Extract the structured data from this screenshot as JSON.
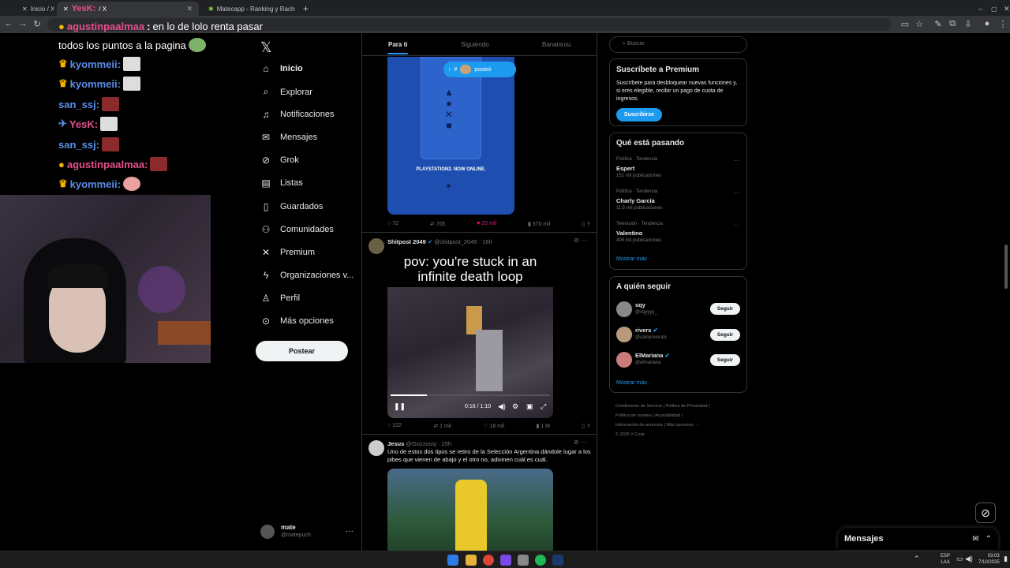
{
  "tabs": [
    {
      "label": "Inicio / X",
      "active": false
    },
    {
      "label": "YesK: ",
      "active": true,
      "suffix": "/ X"
    },
    {
      "label": "Matecapp - Ranking y Racha d",
      "active": false
    }
  ],
  "chat": [
    {
      "user": "agustinpaalmaa",
      "msg": "en lo de lolo renta pasar",
      "color": "#e4508c"
    },
    {
      "user": "",
      "msg": "todos los puntos a la pagina",
      "color": "#fff"
    },
    {
      "user": "kyommeii:",
      "msg": "",
      "color": "#5b8de8"
    },
    {
      "user": "kyommeii:",
      "msg": "",
      "color": "#5b8de8"
    },
    {
      "user": "san_ssj:",
      "msg": "",
      "color": "#5b8de8"
    },
    {
      "user": "YesK:",
      "msg": "",
      "color": "#e4508c"
    },
    {
      "user": "san_ssj:",
      "msg": "",
      "color": "#5b8de8"
    },
    {
      "user": "agustinpaalmaa:",
      "msg": "",
      "color": "#e4508c"
    },
    {
      "user": "kyommeii:",
      "msg": "",
      "color": "#5b8de8"
    }
  ],
  "nav": [
    {
      "label": "Inicio",
      "icon": "home-icon",
      "glyph": "⌂"
    },
    {
      "label": "Explorar",
      "icon": "search-icon",
      "glyph": "⌕"
    },
    {
      "label": "Notificaciones",
      "icon": "bell-icon",
      "glyph": "♫"
    },
    {
      "label": "Mensajes",
      "icon": "mail-icon",
      "glyph": "✉"
    },
    {
      "label": "Grok",
      "icon": "grok-icon",
      "glyph": "⊘"
    },
    {
      "label": "Listas",
      "icon": "list-icon",
      "glyph": "▤"
    },
    {
      "label": "Guardados",
      "icon": "bookmark-icon",
      "glyph": "▯"
    },
    {
      "label": "Comunidades",
      "icon": "communities-icon",
      "glyph": "⚇"
    },
    {
      "label": "Premium",
      "icon": "x-logo-icon",
      "glyph": "✕"
    },
    {
      "label": "Organizaciones v...",
      "icon": "lightning-icon",
      "glyph": "ϟ"
    },
    {
      "label": "Perfil",
      "icon": "person-icon",
      "glyph": "♙"
    },
    {
      "label": "Más opciones",
      "icon": "more-icon",
      "glyph": "⊙"
    }
  ],
  "post_button": "Postear",
  "account": {
    "name": "mate",
    "handle": "@matepuch"
  },
  "feed_tabs": [
    "Para ti",
    "Siguiendo",
    "Bananirou"
  ],
  "posted_pill": "posteó",
  "post1": {
    "poster_text": "PLAYSTATION2. NOW ONLINE.",
    "replies": "72",
    "reposts": "705",
    "likes": "20 mil",
    "views": "570 mil"
  },
  "post2": {
    "name": "Shitpost 2049",
    "handle": "@shitpost_2049 · 16h",
    "caption": "pov: you're stuck in an infinite death loop",
    "time": "0:16 / 1:10",
    "replies": "122",
    "reposts": "1 mil",
    "likes": "18 mil",
    "views": "1 M"
  },
  "post3": {
    "name": "Jesus",
    "handle": "@Gozzossj · 15h",
    "text": "Uno de estos dos tipos se retiro de la Selección Argentina dándole lugar a los pibes que vienen de abajo y el otro no, adivinen cuál es cuál."
  },
  "search_placeholder": "Buscar",
  "premium": {
    "title": "Suscríbete a Premium",
    "body": "Suscríbete para desbloquear nuevas funciones y, si eres elegible, recibir un pago de cuota de ingresos.",
    "button": "Suscribirse"
  },
  "trends": {
    "title": "Qué está pasando",
    "items": [
      {
        "cat": "Política · Tendencia",
        "name": "Espert",
        "count": "151 mil publicaciones"
      },
      {
        "cat": "Política · Tendencia",
        "name": "Charly García",
        "count": "11,5 mil publicaciones"
      },
      {
        "cat": "Televisión · Tendencia",
        "name": "Valentino",
        "count": "406 mil publicaciones"
      }
    ],
    "more": "Mostrar más"
  },
  "follow": {
    "title": "A quién seguir",
    "items": [
      {
        "name": "sqy",
        "handle": "@sqyyyy_"
      },
      {
        "name": "rivers",
        "handle": "@samyriveratv"
      },
      {
        "name": "ElMariana",
        "handle": "@elmariana"
      }
    ],
    "button": "Seguir",
    "more": "Mostrar más"
  },
  "footer": [
    "Condiciones de Servicio",
    "Política de Privacidad",
    "Política de cookies",
    "Accesibilidad",
    "Información de anuncios",
    "Más opciones ···",
    "© 2025 X Corp."
  ],
  "messages_dock": "Mensajes",
  "tray": {
    "lang": "ESP",
    "layout": "LAA",
    "time": "03:03",
    "date": "7/10/2025"
  },
  "colors": {
    "accent": "#1d9bf0",
    "like": "#f91880"
  }
}
